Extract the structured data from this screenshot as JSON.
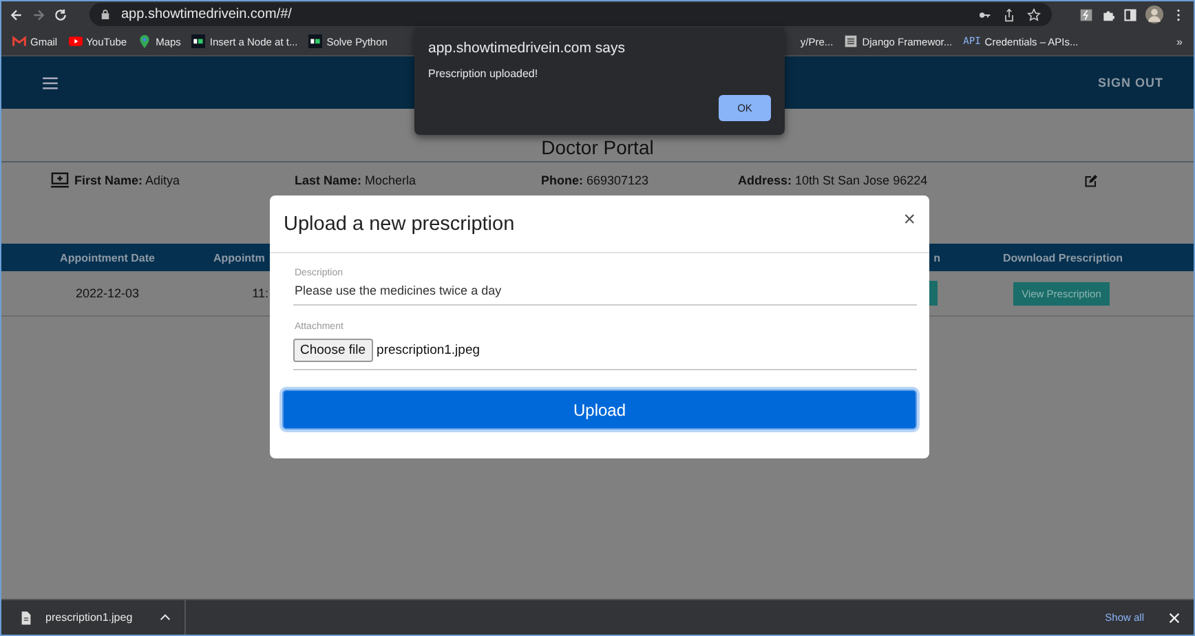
{
  "browser": {
    "url": "app.showtimedrivein.com/#/",
    "bookmarks": [
      {
        "kind": "gmail",
        "label": "Gmail"
      },
      {
        "kind": "youtube",
        "label": "YouTube"
      },
      {
        "kind": "maps",
        "label": "Maps"
      },
      {
        "kind": "site",
        "label": "Insert a Node at t..."
      },
      {
        "kind": "site",
        "label": "Solve Python"
      },
      {
        "kind": "plain",
        "label": "y/Pre..."
      },
      {
        "kind": "doc",
        "label": "Django Framewor..."
      },
      {
        "kind": "api",
        "badge": "API",
        "label": "Credentials – APIs..."
      }
    ],
    "overflow": "»"
  },
  "alert": {
    "origin": "app.showtimedrivein.com says",
    "message": "Prescription uploaded!",
    "button": "OK"
  },
  "navbar": {
    "sign_out": "SIGN OUT"
  },
  "page_title": "Doctor Portal",
  "profile": [
    {
      "label": "First Name:",
      "value": "Aditya"
    },
    {
      "label": "Last Name:",
      "value": "Mocherla"
    },
    {
      "label": "Phone:",
      "value": "669307123"
    },
    {
      "label": "Address:",
      "value": "10th St San Jose 96224"
    }
  ],
  "table": {
    "columns": [
      "Appointment Date",
      "Appointm",
      "n",
      "Download Prescription"
    ],
    "rows": [
      [
        {
          "kind": "text",
          "text": "2022-12-03"
        },
        {
          "kind": "text",
          "text": "11:"
        },
        {
          "kind": "button"
        },
        {
          "kind": "button",
          "text": "View Prescription"
        }
      ]
    ]
  },
  "modal": {
    "title": "Upload a new prescription",
    "close": "×",
    "fields": [
      {
        "kind": "text",
        "label": "Description",
        "value": "Please use the medicines twice a day"
      },
      {
        "kind": "file",
        "label": "Attachment",
        "button": "Choose file",
        "value": "prescription1.jpeg"
      }
    ],
    "submit": "Upload"
  },
  "downloads": {
    "file": "prescription1.jpeg",
    "show_all": "Show all"
  }
}
